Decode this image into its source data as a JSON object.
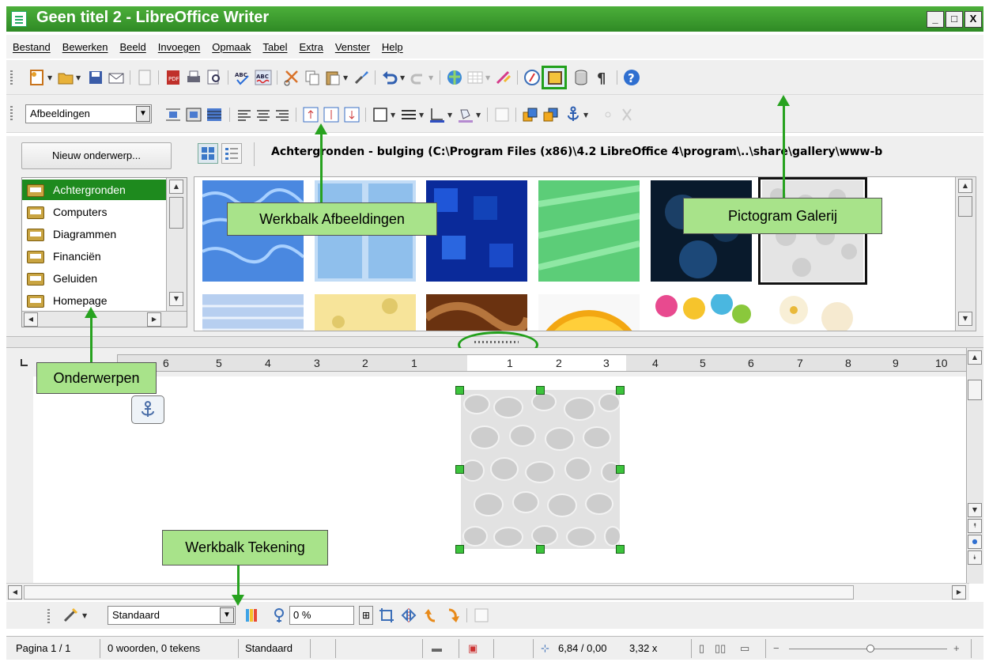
{
  "window": {
    "title": "Geen titel 2 - LibreOffice Writer",
    "minimize": "_",
    "maximize": "□",
    "close": "X"
  },
  "menubar": [
    "Bestand",
    "Bewerken",
    "Beeld",
    "Invoegen",
    "Opmaak",
    "Tabel",
    "Extra",
    "Venster",
    "Help"
  ],
  "toolbar_images": {
    "filter_value": "Afbeeldingen"
  },
  "gallery": {
    "new_topic_button": "Nieuw onderwerp...",
    "path": "Achtergronden - bulging (C:\\Program Files (x86)\\4.2 LibreOffice 4\\program\\..\\share\\gallery\\www-b",
    "topics": [
      "Achtergronden",
      "Computers",
      "Diagrammen",
      "Financiën",
      "Geluiden",
      "Homepage"
    ],
    "selected_topic": "Achtergronden"
  },
  "ruler": {
    "left_numbers": [
      "6",
      "5",
      "4",
      "3",
      "2",
      "1"
    ],
    "right_numbers": [
      "1",
      "2",
      "3",
      "4",
      "5",
      "6",
      "7",
      "8",
      "9",
      "10"
    ]
  },
  "drawing_toolbar": {
    "style_value": "Standaard",
    "transparency_value": "0 %"
  },
  "statusbar": {
    "page": "Pagina 1 / 1",
    "words": "0 woorden, 0 tekens",
    "style": "Standaard",
    "position": "6,84 / 0,00",
    "size": "3,32 x"
  },
  "callouts": {
    "images_toolbar": "Werkbalk Afbeeldingen",
    "gallery_icon": "Pictogram Galerij",
    "topics": "Onderwerpen",
    "drawing_toolbar": "Werkbalk Tekening"
  },
  "colors": {
    "title_green": "#3a9c2e",
    "selection_green": "#1e8a1e",
    "callout_fill": "#a8e38a",
    "arrow_green": "#27a21f"
  }
}
